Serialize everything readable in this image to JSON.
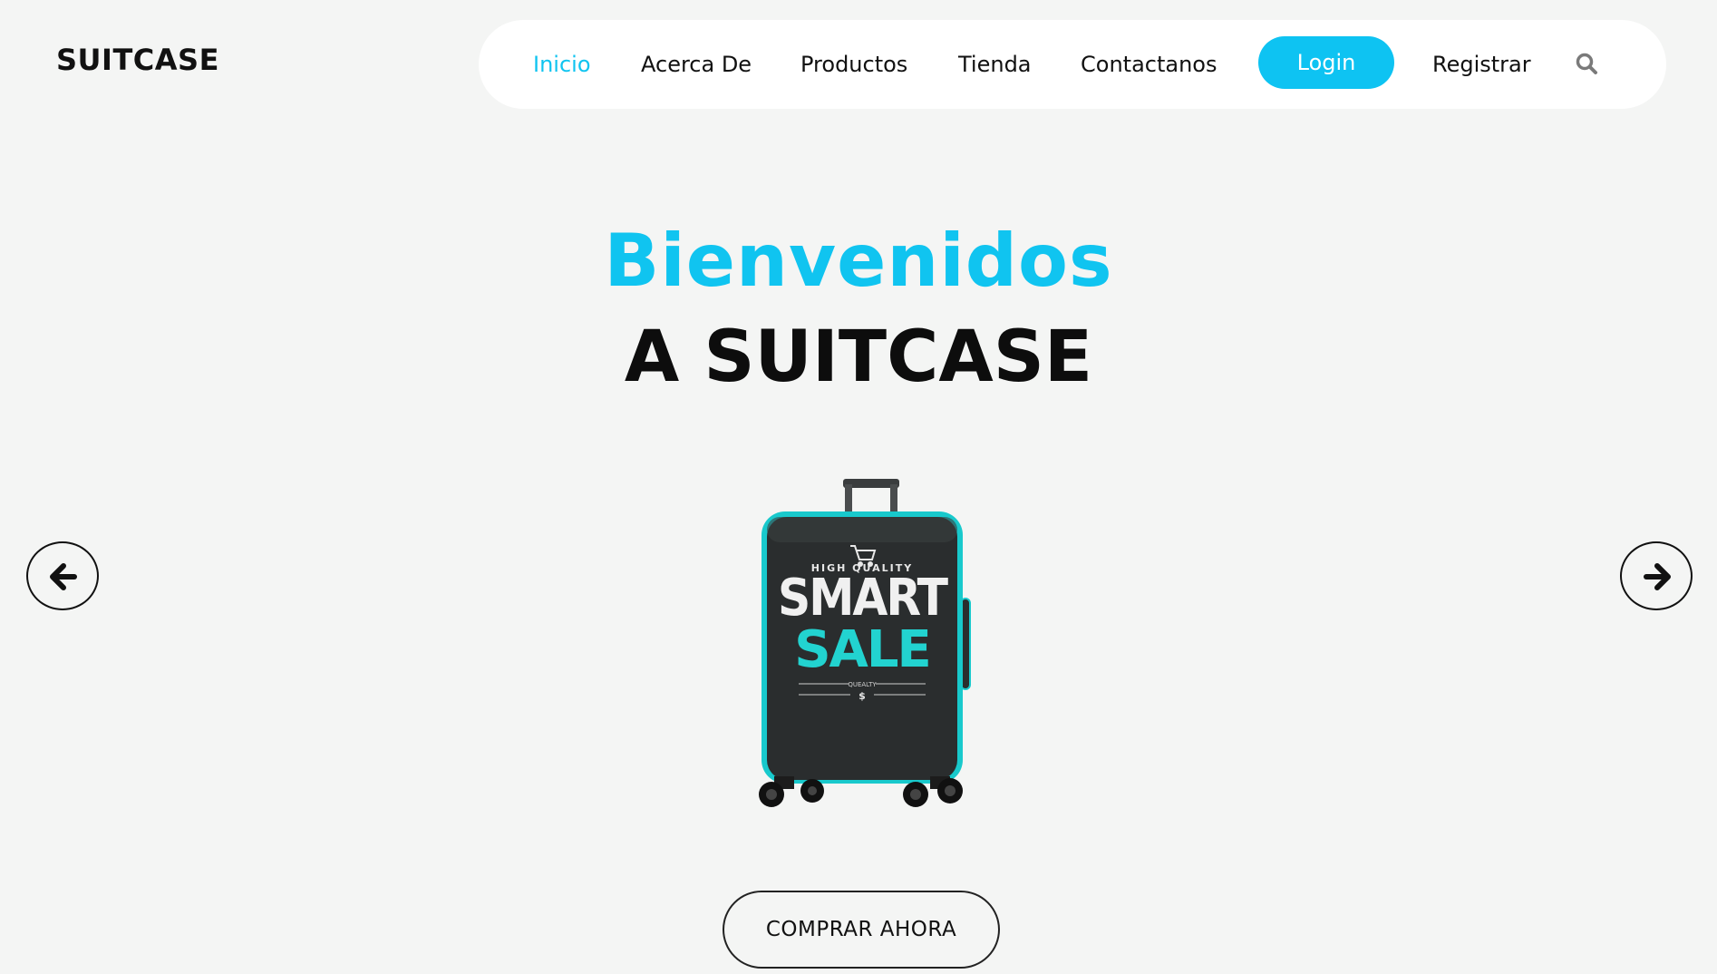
{
  "brand": {
    "logo_text": "SUITCASE"
  },
  "nav": {
    "items": [
      {
        "label": "Inicio",
        "active": true
      },
      {
        "label": "Acerca De",
        "active": false
      },
      {
        "label": "Productos",
        "active": false
      },
      {
        "label": "Tienda",
        "active": false
      },
      {
        "label": "Contactanos",
        "active": false
      }
    ],
    "login_label": "Login",
    "register_label": "Registrar",
    "search_icon": "search-icon"
  },
  "hero": {
    "title_line1": "Bienvenidos",
    "title_line2": "A SUITCASE",
    "cta_label": "COMPRAR AHORA",
    "prev_icon": "arrow-left-icon",
    "next_icon": "arrow-right-icon"
  },
  "product_image": {
    "tagline": "HIGH QUALITY",
    "line1": "SMART",
    "line2": "SALE",
    "small_text": "QUEALTY",
    "symbol": "$"
  },
  "colors": {
    "accent": "#0ec3f2",
    "background": "#f4f5f4",
    "text": "#111111",
    "suitcase_body": "#2a2d2e",
    "suitcase_trim": "#18c9cc"
  }
}
